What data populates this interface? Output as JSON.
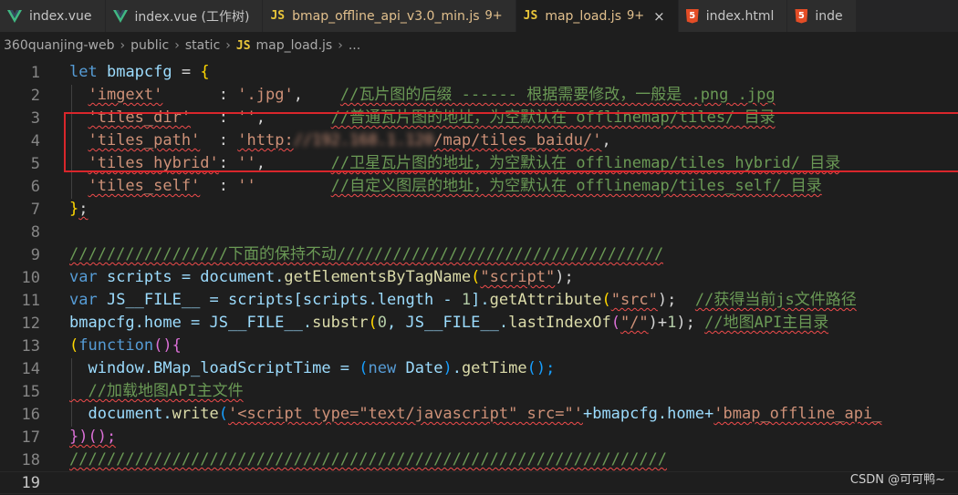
{
  "tabs": [
    {
      "label": "index.vue",
      "icon": "vue-icon",
      "style": "normal"
    },
    {
      "label": "index.vue (工作树)",
      "icon": "vue-icon",
      "style": "normal"
    },
    {
      "label": "bmap_offline_api_v3.0_min.js",
      "icon": "js-icon",
      "icon_text": "JS",
      "count": "9+",
      "style": "warn"
    },
    {
      "label": "map_load.js",
      "icon": "js-icon",
      "icon_text": "JS",
      "count": "9+",
      "style": "warn",
      "active": true,
      "close": "×"
    },
    {
      "label": "index.html",
      "icon": "html-icon",
      "icon_text": "5",
      "style": "normal"
    },
    {
      "label": "inde",
      "icon": "html-icon",
      "icon_text": "5",
      "style": "normal"
    }
  ],
  "breadcrumb": {
    "items": [
      "360quanjing-web",
      "public",
      "static",
      "map_load.js",
      "..."
    ],
    "file_icon_text": "JS",
    "separator": "›"
  },
  "line_numbers": [
    "1",
    "2",
    "3",
    "4",
    "5",
    "6",
    "7",
    "8",
    "9",
    "10",
    "11",
    "12",
    "13",
    "14",
    "15",
    "16",
    "17",
    "18",
    "19"
  ],
  "code": {
    "l1": {
      "kw": "let",
      "name": "bmapcfg",
      "eq": " = ",
      "brace": "{"
    },
    "l2": {
      "key": "'imgext'",
      "pad": "      : ",
      "val": "'.jpg'",
      "comma": ",    ",
      "comment": "//瓦片图的后缀 ------ 根据需要修改，一般是 .png .jpg"
    },
    "l3": {
      "key": "'tiles_dir'",
      "pad": "   : ",
      "val": "''",
      "comma": ",       ",
      "comment": "//普通瓦片图的地址，为空默认在 offlinemap/tiles/ 目录"
    },
    "l4": {
      "key": "'tiles_path'",
      "pad": "  : ",
      "val_start": "'http:",
      "val_blur": "//192.168.1.120",
      "val_end": "/map/tiles_baidu/'",
      "comma": ","
    },
    "l5": {
      "key": "'tiles_hybrid'",
      "pad": ": ",
      "val": "''",
      "comma": ",       ",
      "comment": "//卫星瓦片图的地址，为空默认在 offlinemap/tiles_hybrid/ 目录"
    },
    "l6": {
      "key": "'tiles_self'",
      "pad": "  : ",
      "val": "''",
      "comma": "        ",
      "comment": "//自定义图层的地址，为空默认在 offlinemap/tiles_self/ 目录"
    },
    "l7": {
      "brace": "}",
      "semi": ";"
    },
    "l9": {
      "comment": "/////////////////下面的保持不动///////////////////////////////////"
    },
    "l10": {
      "kw": "var",
      "rest1": " scripts = document.",
      "fn": "getElementsByTagName",
      "p1": "(",
      "str": "\"script\"",
      "p2": ");"
    },
    "l11": {
      "kw": "var",
      "rest1": " JS__FILE__ = scripts[scripts.length - ",
      "num": "1",
      "rest2": "].",
      "fn": "getAttribute",
      "p1": "(",
      "str": "\"src\"",
      "p2": ");  ",
      "comment": "//获得当前js文件路径"
    },
    "l12": {
      "rest1": "bmapcfg.home = JS__FILE__.",
      "fn1": "substr",
      "p1": "(",
      "num": "0",
      "rest2": ", JS__FILE__.",
      "fn2": "lastIndexOf",
      "p2": "(",
      "str": "\"/\"",
      "p3": ")+",
      "num2": "1",
      "p4": "); ",
      "comment": "//地图API主目录"
    },
    "l13": {
      "paren": "(",
      "kw": "function",
      "rest": "(){"
    },
    "l14": {
      "rest1": "  window.BMap_loadScriptTime = ",
      "p1": "(",
      "kw": "new",
      "cls": " Date",
      "p2": ")",
      "rest2": ".",
      "fn": "getTime",
      "p3": "();"
    },
    "l15": {
      "comment": "  //加载地图API主文件"
    },
    "l16": {
      "rest1": "  document.",
      "fn": "write",
      "p1": "(",
      "str1": "'<script type=\"text/javascript\" src=\"'",
      "rest2": "+bmapcfg.home+",
      "str2": "'bmap_offline_api_"
    },
    "l17": {
      "text": "})();"
    },
    "l18": {
      "comment": "////////////////////////////////////////////////////////////////"
    }
  },
  "watermark": "CSDN @可可鸭~",
  "colors": {
    "keyword": "#569cd6",
    "string": "#ce9178",
    "comment": "#6a9955",
    "function": "#dcdcaa",
    "variable": "#9cdcfe",
    "highlight_box": "#d9262b"
  }
}
